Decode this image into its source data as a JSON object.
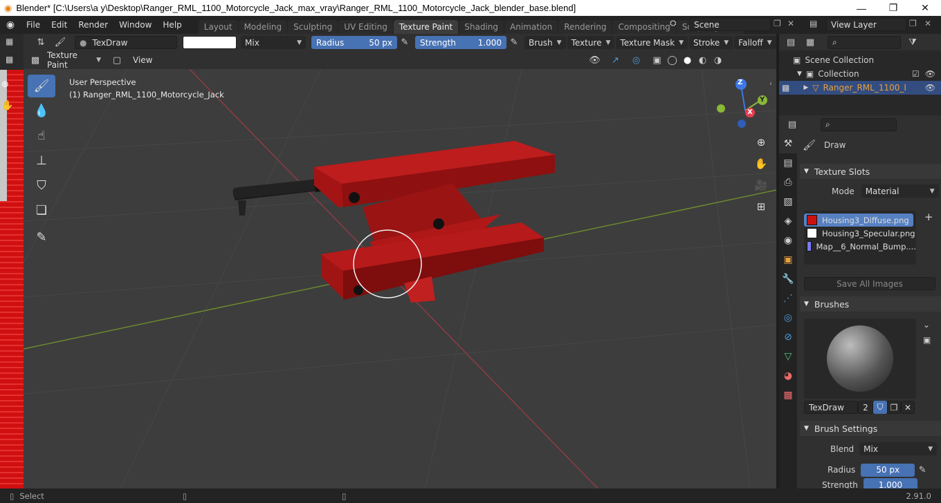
{
  "window": {
    "title": "Blender* [C:\\Users\\a y\\Desktop\\Ranger_RML_1100_Motorcycle_Jack_max_vray\\Ranger_RML_1100_Motorcycle_Jack_blender_base.blend]"
  },
  "menu": [
    "File",
    "Edit",
    "Render",
    "Window",
    "Help"
  ],
  "workspaces": [
    "Layout",
    "Modeling",
    "Sculpting",
    "UV Editing",
    "Texture Paint",
    "Shading",
    "Animation",
    "Rendering",
    "Compositing",
    "Scripting"
  ],
  "active_workspace": "Texture Paint",
  "scene": "Scene",
  "view_layer": "View Layer",
  "tool_header": {
    "brush_name": "TexDraw",
    "blend": "Mix",
    "radius_label": "Radius",
    "radius_value": "50 px",
    "strength_label": "Strength",
    "strength_value": "1.000",
    "menus": [
      "Brush",
      "Texture",
      "Texture Mask",
      "Stroke",
      "Falloff"
    ]
  },
  "viewport_header": {
    "mode": "Texture Paint",
    "view": "View"
  },
  "viewport": {
    "perspective": "User Perspective",
    "object": "(1) Ranger_RML_1100_Motorcycle_Jack",
    "gizmo": {
      "z": "Z",
      "y": "Y",
      "x": "X"
    }
  },
  "outliner": {
    "scene_collection": "Scene Collection",
    "collection": "Collection",
    "object": "Ranger_RML_1100_I"
  },
  "properties": {
    "tool_name": "Draw",
    "texture_slots": {
      "title": "Texture Slots",
      "mode_label": "Mode",
      "mode_value": "Material",
      "slots": [
        {
          "name": "Housing3_Diffuse.png",
          "color": "#cc1111"
        },
        {
          "name": "Housing3_Specular.png",
          "color": "#ffffff"
        },
        {
          "name": "Map__6_Normal_Bump....",
          "color": "#7b7bf0"
        }
      ],
      "save_all": "Save All Images"
    },
    "brushes": {
      "title": "Brushes",
      "name": "TexDraw",
      "users": "2"
    },
    "brush_settings": {
      "title": "Brush Settings",
      "blend_label": "Blend",
      "blend_value": "Mix",
      "radius_label": "Radius",
      "radius_value": "50 px",
      "strength_label": "Strength",
      "strength_value": "1.000"
    }
  },
  "status": {
    "action": "Select",
    "version": "2.91.0"
  },
  "colors": {
    "accent": "#4772b3",
    "jack_red": "#b01818",
    "active_slot": "#5680c2"
  }
}
